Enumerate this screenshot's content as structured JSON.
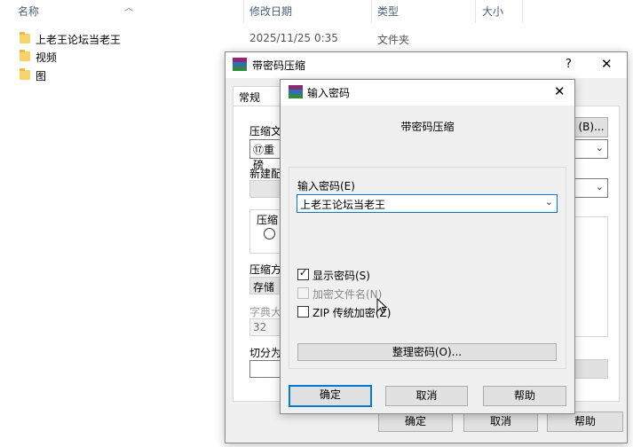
{
  "explorer": {
    "columns": {
      "name": "名称",
      "date": "修改日期",
      "type": "类型",
      "size": "大小"
    },
    "rows": [
      {
        "name": "上老王论坛当老王",
        "date": "2025/11/25 0:35",
        "type": "文件夹"
      },
      {
        "name": "视频",
        "date": "",
        "type": ""
      },
      {
        "name": "图",
        "date": "",
        "type": ""
      }
    ]
  },
  "back_dialog": {
    "title": "带密码压缩",
    "help": "?",
    "close": "✕",
    "tab_general": "常规",
    "archive_name_label": "压缩文",
    "archive_name_value": "⑰重磅",
    "browse": "(B)...",
    "new_config_label": "新建配",
    "format_group": "压缩",
    "method_label": "压缩方",
    "method_value": "存储",
    "dict_label": "字典大",
    "dict_value": "32",
    "split_label": "切分为",
    "ok": "确定",
    "cancel": "取消",
    "help_btn": "帮助"
  },
  "pwd_dialog": {
    "title": "输入密码",
    "close": "✕",
    "heading": "带密码压缩",
    "enter_label": "输入密码(E)",
    "password_value": "上老王论坛当老王",
    "show_password": "显示密码(S)",
    "show_password_checked": true,
    "encrypt_names": "加密文件名(N)",
    "encrypt_names_enabled": false,
    "zip_legacy": "ZIP 传统加密(Z)",
    "organize": "整理密码(O)...",
    "ok": "确定",
    "cancel": "取消",
    "help": "帮助"
  }
}
